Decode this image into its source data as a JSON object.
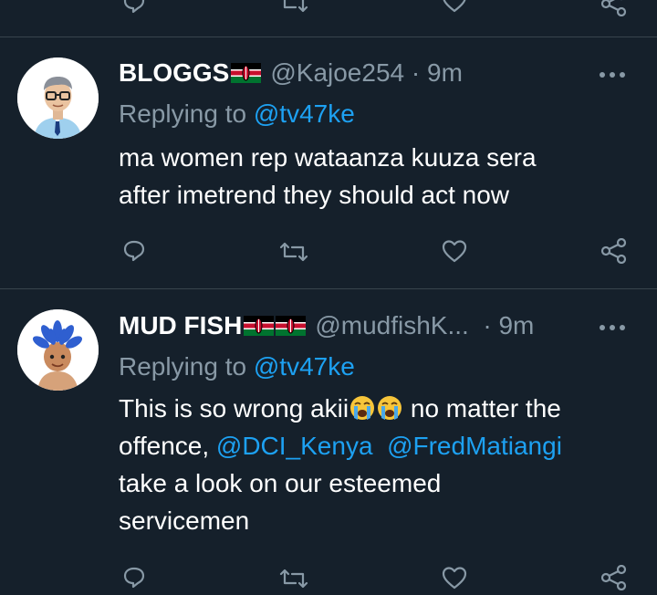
{
  "tweets": [
    {
      "name": "BLOGGS",
      "handle": "@Kajoe254",
      "separator": "·",
      "time": "9m",
      "replying_label": "Replying to",
      "replying_to": "@tv47ke",
      "body": {
        "line1": "ma women rep wataanza kuuza sera",
        "line2": "after imetrend they should act now"
      }
    },
    {
      "name": "MUD FISH",
      "handle": "@mudfishK...",
      "separator": "·",
      "time": "9m",
      "replying_label": "Replying to",
      "replying_to": "@tv47ke",
      "body": {
        "line1_text": "This is so wrong akii",
        "line1_after": " no matter the",
        "line2_text": "offence, ",
        "mention1": "@DCI_Kenya",
        "mention2": "@FredMatiangi",
        "line3": " take a look on our esteemed",
        "line4": "servicemen"
      }
    }
  ],
  "colors": {
    "background": "#15202b",
    "text": "#ffffff",
    "muted": "#8899a6",
    "link": "#1da1f2",
    "divider": "#38444d"
  },
  "icons": {
    "actions": [
      "reply-icon",
      "retweet-icon",
      "like-icon",
      "share-icon"
    ],
    "flag": "kenya-flag-icon",
    "emoji": "loudly-crying-face-icon"
  }
}
